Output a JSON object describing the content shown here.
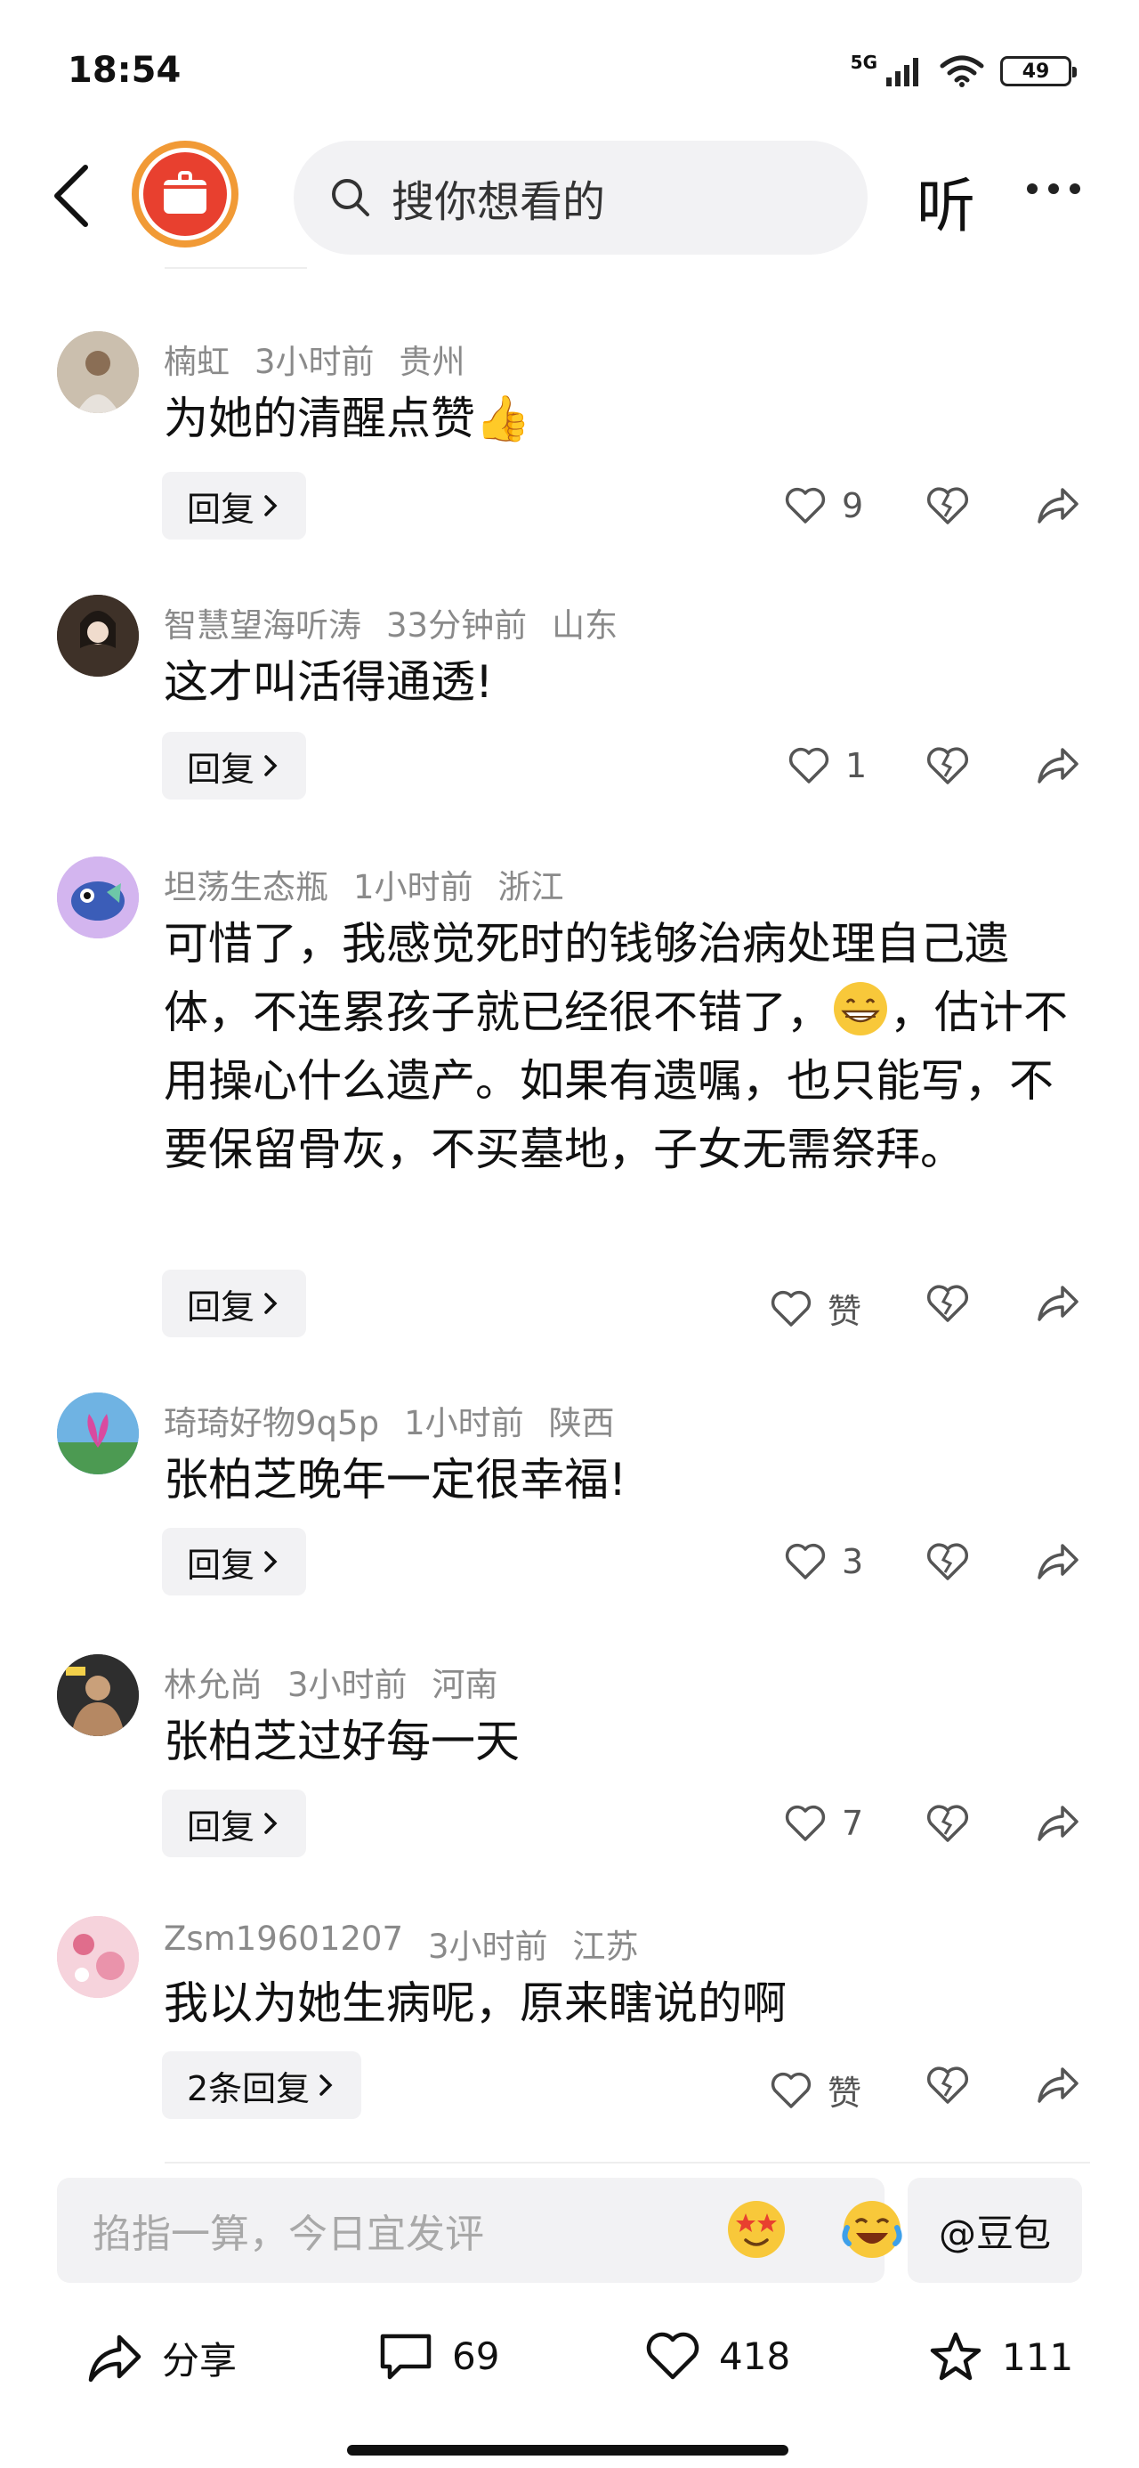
{
  "status": {
    "time": "18:54",
    "network": "5G",
    "battery": "49"
  },
  "nav": {
    "search_placeholder": "搜你想看的",
    "listen_label": "听"
  },
  "comments": [
    {
      "username": "楠虹",
      "time": "3小时前",
      "location": "贵州",
      "text": "为她的清醒点赞👍",
      "reply_label": "回复",
      "like_count": "9",
      "avatar_color": "#b9a692"
    },
    {
      "username": "智慧望海听涛",
      "time": "33分钟前",
      "location": "山东",
      "text": "这才叫活得通透!",
      "reply_label": "回复",
      "like_count": "1",
      "avatar_color": "#4a3b30"
    },
    {
      "username": "坦荡生态瓶",
      "time": "1小时前",
      "location": "浙江",
      "text_part1": "可惜了，我感觉死时的钱够治病处理自己遗体，不连累孩子就已经很不错了，",
      "text_part2": "，估计不用操心什么遗产。如果有遗嘱，也只能写，不要保留骨灰，不买墓地，子女无需祭拜。",
      "reply_label": "回复",
      "like_count": "赞",
      "avatar_color": "#c9a6e8"
    },
    {
      "username": "琦琦好物9q5p",
      "time": "1小时前",
      "location": "陕西",
      "text": "张柏芝晚年一定很幸福!",
      "reply_label": "回复",
      "like_count": "3",
      "avatar_color": "#5aa0d8"
    },
    {
      "username": "林允尚",
      "time": "3小时前",
      "location": "河南",
      "text": "张柏芝过好每一天",
      "reply_label": "回复",
      "like_count": "7",
      "avatar_color": "#3c3c3c"
    },
    {
      "username": "Zsm19601207",
      "time": "3小时前",
      "location": "江苏",
      "text": "我以为她生病呢，原来瞎说的啊",
      "reply_label": "2条回复",
      "like_count": "赞",
      "avatar_color": "#f0b8c6"
    }
  ],
  "input": {
    "placeholder": "掐指一算，今日宜发评",
    "doubao_label": "@豆包"
  },
  "bottom_bar": {
    "share_label": "分享",
    "comment_count": "69",
    "like_count": "418",
    "favorite_count": "111"
  }
}
